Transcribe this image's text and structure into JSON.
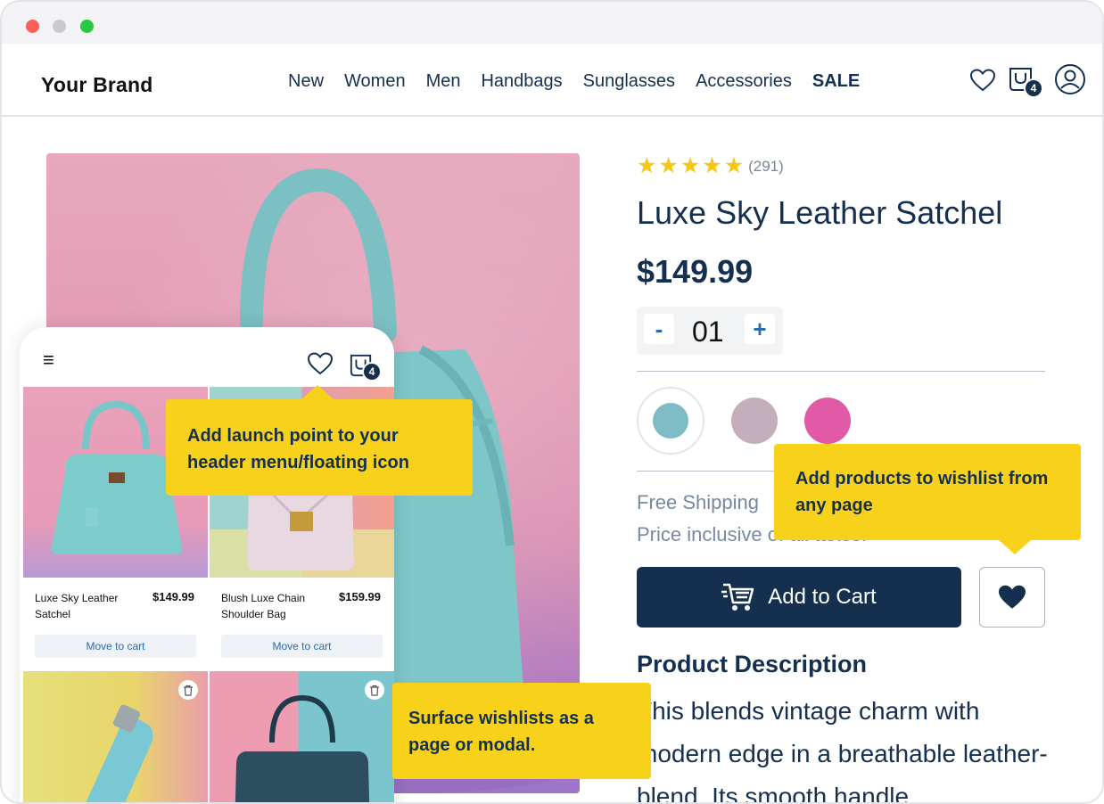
{
  "header": {
    "brand": "Your Brand",
    "nav": [
      "New",
      "Women",
      "Men",
      "Handbags",
      "Sunglasses",
      "Accessories"
    ],
    "nav_sale": "SALE",
    "cart_count": "4",
    "icons": [
      "heart-icon",
      "cart-icon",
      "user-icon"
    ]
  },
  "product": {
    "rating_count": "(291)",
    "rating_stars": 5,
    "title": "Luxe Sky Leather Satchel",
    "price": "$149.99",
    "qty_minus": "-",
    "qty_value": "01",
    "qty_plus": "+",
    "swatches": [
      "#7fbcc6",
      "#c5aebb",
      "#e05aa7"
    ],
    "free_shipping": "Free Shipping",
    "price_inclusive": "Price inclusive of all taxes.",
    "add_to_cart": "Add to Cart",
    "desc_heading": "Product Description",
    "desc_text": "This blends vintage charm with modern edge in a breathable leather-blend. Its smooth handle"
  },
  "phone": {
    "menu_glyph": "≡",
    "cart_count": "4",
    "items": [
      {
        "name": "Luxe Sky Leather Satchel",
        "price": "$149.99",
        "action": "Move to cart"
      },
      {
        "name": "Blush Luxe Chain Shoulder Bag",
        "price": "$159.99",
        "action": "Move to cart"
      }
    ]
  },
  "tooltips": {
    "launch_point": "Add launch point to your header menu/floating icon",
    "add_products": "Add products to wishlist from any page",
    "surface": "Surface wishlists as a page or modal."
  },
  "colors": {
    "primary": "#15304f",
    "tooltip": "#f8d21a",
    "star": "#f7c613",
    "link": "#2a6bb0"
  }
}
